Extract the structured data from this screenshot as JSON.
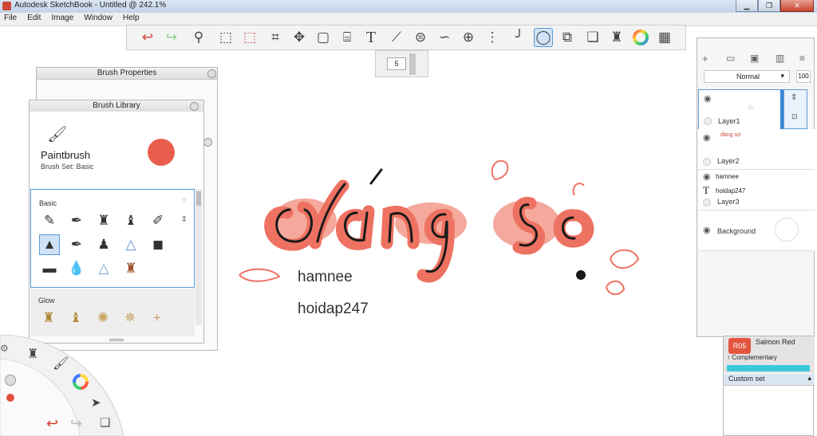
{
  "window": {
    "title": "Autodesk SketchBook - Untitled @ 242.1%",
    "minimize": "▁",
    "maximize": "❐",
    "close": "✕"
  },
  "menu": [
    "File",
    "Edit",
    "Image",
    "Window",
    "Help"
  ],
  "toolbar_icons": [
    "undo-icon",
    "redo-icon",
    "zoom-icon",
    "select-icon",
    "crop-select-icon",
    "crop-icon",
    "transform-icon",
    "distort-icon",
    "cylinder-icon",
    "text-icon",
    "ruler-icon",
    "ellipse-guide-icon",
    "french-curve-icon",
    "perspective-icon",
    "symmetry-icon",
    "stroke-icon",
    "ellipse-icon",
    "shape-icon",
    "copy-icon",
    "brush-palette-icon",
    "color-wheel-icon",
    "grid-icon"
  ],
  "brush_size": {
    "value": "5"
  },
  "brush_properties": {
    "title": "Brush Properties"
  },
  "brush_library": {
    "title": "Brush Library",
    "current_brush": "Paintbrush",
    "brush_set": "Brush Set: Basic",
    "current_color": "#ea5c4c",
    "section_basic": "Basic",
    "section_glow": "Glow"
  },
  "layers": {
    "blend_mode": "Normal",
    "opacity": "100",
    "items": [
      {
        "name": "Layer1",
        "selected": true
      },
      {
        "name": "Layer2",
        "thumb_text": "đáng sợ"
      },
      {
        "name": "Layer3",
        "lines": [
          "hamnee",
          "hoidap247"
        ]
      },
      {
        "name": "Background"
      }
    ]
  },
  "color_panel": {
    "swatch_code": "R05",
    "swatch_name": "Salmon Red",
    "complementary": "↑ Complementary",
    "custom_set": "Custom set"
  },
  "canvas": {
    "headline": "đáng sợ",
    "line1": "hamnee",
    "line2": "hoidap247",
    "colors": {
      "salmon": "#ee7262",
      "pink": "#f6b3a8",
      "ink": "#1a1a1a"
    }
  }
}
